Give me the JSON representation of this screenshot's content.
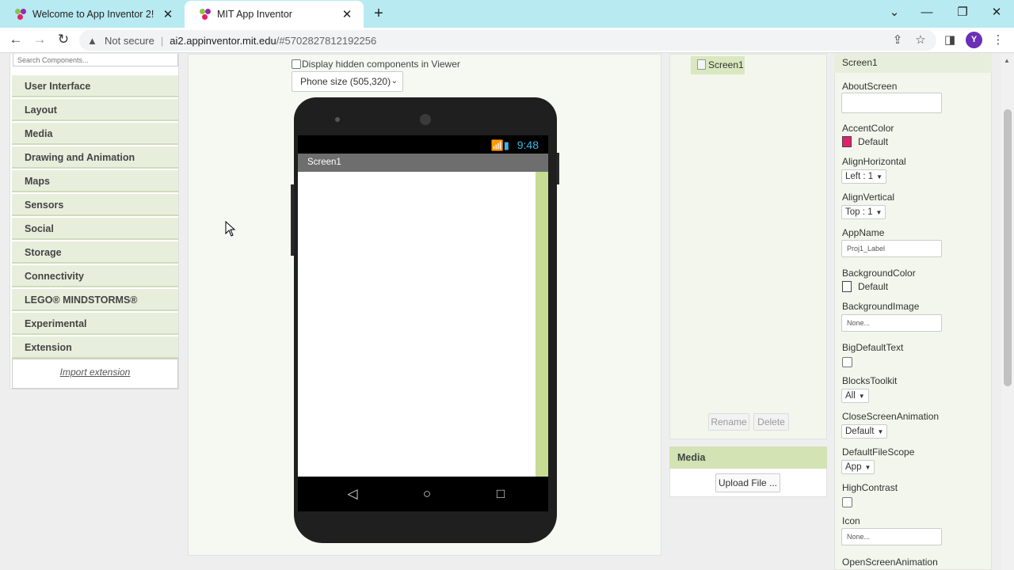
{
  "browser": {
    "tabs": [
      {
        "title": "Welcome to App Inventor 2!",
        "active": false
      },
      {
        "title": "MIT App Inventor",
        "active": true
      }
    ],
    "new_tab": "+",
    "window_controls": [
      "⌄",
      "—",
      "❐",
      "✕"
    ],
    "address": {
      "security": "Not secure",
      "host": "ai2.appinventor.mit.edu",
      "path": "/#5702827812192256"
    },
    "profile_initial": "Y"
  },
  "palette": {
    "search_placeholder": "Search Components...",
    "categories": [
      "User Interface",
      "Layout",
      "Media",
      "Drawing and Animation",
      "Maps",
      "Sensors",
      "Social",
      "Storage",
      "Connectivity",
      "LEGO® MINDSTORMS®",
      "Experimental",
      "Extension"
    ],
    "import_extension": "Import extension"
  },
  "viewer": {
    "hidden_components_label": "Display hidden components in Viewer",
    "size_select": "Phone size (505,320)",
    "phone": {
      "time": "9:48",
      "screen_title": "Screen1"
    }
  },
  "components": {
    "tree": [
      "Screen1"
    ],
    "rename": "Rename",
    "delete": "Delete"
  },
  "media": {
    "title": "Media",
    "upload": "Upload File ..."
  },
  "properties": {
    "title": "Screen1",
    "about_screen": {
      "label": "AboutScreen",
      "value": ""
    },
    "accent_color": {
      "label": "AccentColor",
      "value": "Default",
      "swatch": "#e0226a"
    },
    "align_horizontal": {
      "label": "AlignHorizontal",
      "value": "Left : 1"
    },
    "align_vertical": {
      "label": "AlignVertical",
      "value": "Top : 1"
    },
    "app_name": {
      "label": "AppName",
      "value": "Proj1_Label"
    },
    "background_color": {
      "label": "BackgroundColor",
      "value": "Default",
      "swatch": "#ffffff"
    },
    "background_image": {
      "label": "BackgroundImage",
      "value": "None..."
    },
    "big_default_text": {
      "label": "BigDefaultText",
      "checked": false
    },
    "blocks_toolkit": {
      "label": "BlocksToolkit",
      "value": "All"
    },
    "close_screen_animation": {
      "label": "CloseScreenAnimation",
      "value": "Default"
    },
    "default_file_scope": {
      "label": "DefaultFileScope",
      "value": "App"
    },
    "high_contrast": {
      "label": "HighContrast",
      "checked": false
    },
    "icon": {
      "label": "Icon",
      "value": "None..."
    },
    "open_screen_animation": {
      "label": "OpenScreenAnimation"
    }
  },
  "colors": {
    "tabbar": "#b8eaf2",
    "category_bg": "#e7efdc",
    "phone_body": "#1f1f1f",
    "status_text": "#36b8e6",
    "scroll_strip": "#c6dc92",
    "avatar": "#6a2fb5"
  }
}
